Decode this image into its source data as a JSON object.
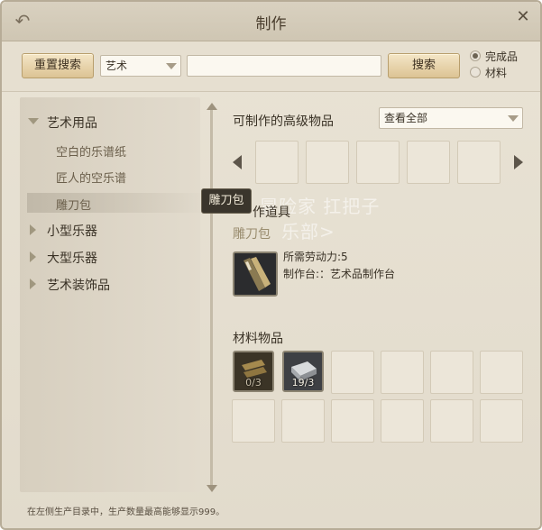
{
  "window": {
    "title": "制作"
  },
  "search": {
    "reset_label": "重置搜索",
    "category_value": "艺术",
    "query_value": "",
    "search_label": "搜索",
    "radio_options": [
      {
        "label": "完成品",
        "selected": true
      },
      {
        "label": "材料",
        "selected": false
      }
    ]
  },
  "tree": {
    "groups": [
      {
        "label": "艺术用品",
        "expanded": true,
        "children": [
          "空白的乐谱纸",
          "匠人的空乐谱",
          "雕刀包"
        ]
      },
      {
        "label": "小型乐器",
        "expanded": false
      },
      {
        "label": "大型乐器",
        "expanded": false
      },
      {
        "label": "艺术装饰品",
        "expanded": false
      }
    ],
    "selected": "雕刀包"
  },
  "tooltip": "雕刀包",
  "advanced": {
    "title": "可制作的高级物品",
    "view_select": "查看全部"
  },
  "craft": {
    "section_title_partial": "作道具",
    "item_name": "雕刀包",
    "labor_line": "所需劳动力:5",
    "station_line": "制作台:：艺术品制作台"
  },
  "materials": {
    "title": "材料物品",
    "items": [
      {
        "icon": "wood-plank-icon",
        "count": "0/3"
      },
      {
        "icon": "iron-ingot-icon",
        "count": "19/3"
      }
    ]
  },
  "watermark": {
    "line1": "冒险家 扛把子",
    "line2": "乐部>"
  },
  "footer": "在左侧生产目录中，生产数量最高能够显示999。",
  "colors": {
    "accent_gold": "#dcc394",
    "panel_bg": "#e6dfd0",
    "item_name": "#9a8d6f"
  }
}
